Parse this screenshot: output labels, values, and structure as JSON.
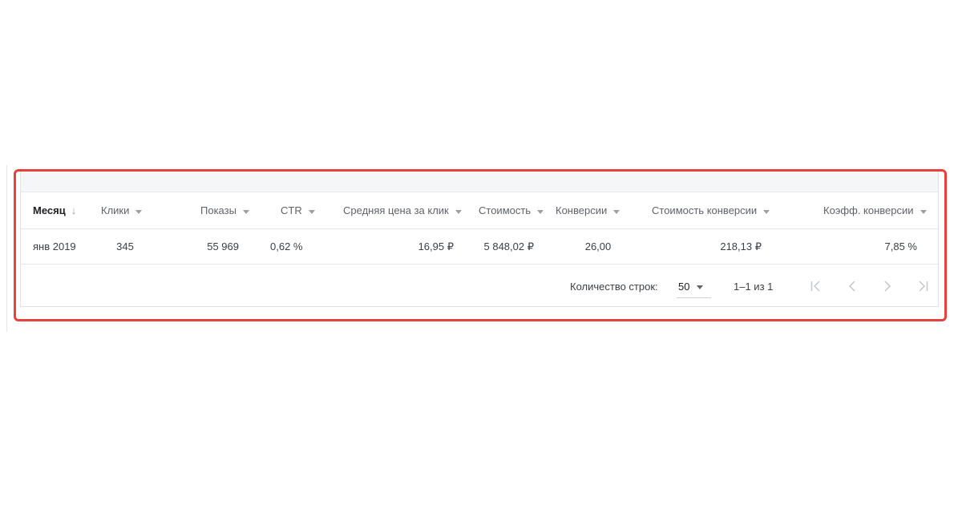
{
  "table": {
    "columns": [
      {
        "label": "Месяц",
        "sort_icon": "arrow-down-icon"
      },
      {
        "label": "Клики",
        "sort_icon": "caret-down-icon"
      },
      {
        "label": "Показы",
        "sort_icon": "caret-down-icon"
      },
      {
        "label": "CTR",
        "sort_icon": "caret-down-icon"
      },
      {
        "label": "Средняя цена за клик",
        "sort_icon": "caret-down-icon"
      },
      {
        "label": "Стоимость",
        "sort_icon": "caret-down-icon"
      },
      {
        "label": "Конверсии",
        "sort_icon": "caret-down-icon"
      },
      {
        "label": "Стоимость конверсии",
        "sort_icon": "caret-down-icon"
      },
      {
        "label": "Коэфф. конверсии",
        "sort_icon": "caret-down-icon"
      }
    ],
    "rows": [
      [
        "янв 2019",
        "345",
        "55 969",
        "0,62 %",
        "16,95 ₽",
        "5 848,02 ₽",
        "26,00",
        "218,13 ₽",
        "7,85 %"
      ]
    ]
  },
  "pagination": {
    "rows_label": "Количество строк:",
    "rows_per_page": "50",
    "range": "1–1 из 1",
    "buttons": [
      "first-page-icon",
      "previous-page-icon",
      "next-page-icon",
      "last-page-icon"
    ]
  },
  "colors": {
    "highlight_border": "#e8403a",
    "header_band": "#f5f6f7",
    "divider": "#e3e5e8",
    "disabled_icon": "#c4c7cc"
  }
}
